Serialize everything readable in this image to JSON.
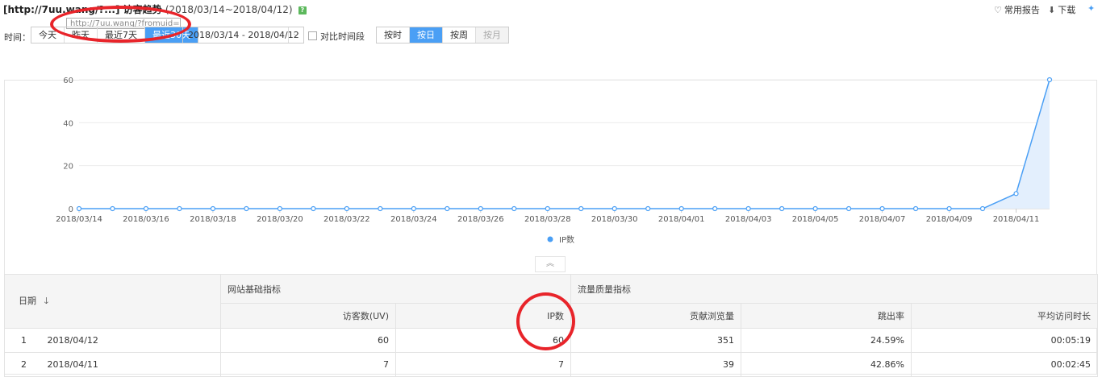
{
  "header": {
    "title": "[http://7uu.wang/?...] 访客趋势",
    "range": "(2018/03/14~2018/04/12)",
    "badge": "?",
    "url_tooltip": "http://7uu.wang/?fromuid=1",
    "report_link": "常用报告",
    "download_link": "下载",
    "pin_icon": "pin-icon"
  },
  "toolbar": {
    "time_label": "时间：",
    "quick_ranges": [
      "今天",
      "昨天",
      "最近7天",
      "最近30天"
    ],
    "active_quick_range": "最近30天",
    "date_range_value": "2018/03/14 - 2018/04/12",
    "compare_label": "对比时间段",
    "granularity": [
      "按时",
      "按日",
      "按周",
      "按月"
    ],
    "active_granularity": "按日",
    "disabled_granularity": "按月"
  },
  "chart_data": {
    "type": "area",
    "series": [
      {
        "name": "IP数",
        "values": [
          0,
          0,
          0,
          0,
          0,
          0,
          0,
          0,
          0,
          0,
          0,
          0,
          0,
          0,
          0,
          0,
          0,
          0,
          0,
          0,
          0,
          0,
          0,
          0,
          0,
          0,
          0,
          0,
          7,
          60
        ]
      }
    ],
    "x": [
      "2018/03/14",
      "2018/03/15",
      "2018/03/16",
      "2018/03/17",
      "2018/03/18",
      "2018/03/19",
      "2018/03/20",
      "2018/03/21",
      "2018/03/22",
      "2018/03/23",
      "2018/03/24",
      "2018/03/25",
      "2018/03/26",
      "2018/03/27",
      "2018/03/28",
      "2018/03/29",
      "2018/03/30",
      "2018/03/31",
      "2018/04/01",
      "2018/04/02",
      "2018/04/03",
      "2018/04/04",
      "2018/04/05",
      "2018/04/06",
      "2018/04/07",
      "2018/04/08",
      "2018/04/09",
      "2018/04/10",
      "2018/04/11",
      "2018/04/12"
    ],
    "x_tick_labels": [
      "2018/03/14",
      "2018/03/16",
      "2018/03/18",
      "2018/03/20",
      "2018/03/22",
      "2018/03/24",
      "2018/03/26",
      "2018/03/28",
      "2018/03/30",
      "2018/04/01",
      "2018/04/03",
      "2018/04/05",
      "2018/04/07",
      "2018/04/09",
      "2018/04/11"
    ],
    "y_ticks": [
      0,
      20,
      40,
      60
    ],
    "ylim": [
      0,
      60
    ],
    "legend": "bottom-center",
    "color": "#4a9ff5",
    "fill_color": "#e3effd"
  },
  "table": {
    "date_header": "日期",
    "group_headers": [
      "网站基础指标",
      "流量质量指标"
    ],
    "columns": [
      "访客数(UV)",
      "IP数",
      "贡献浏览量",
      "跳出率",
      "平均访问时长"
    ],
    "rows": [
      {
        "idx": "1",
        "date": "2018/04/12",
        "uv": "60",
        "ip": "60",
        "pv": "351",
        "bounce": "24.59%",
        "avg": "00:05:19"
      },
      {
        "idx": "2",
        "date": "2018/04/11",
        "uv": "7",
        "ip": "7",
        "pv": "39",
        "bounce": "42.86%",
        "avg": "00:02:45"
      }
    ]
  }
}
